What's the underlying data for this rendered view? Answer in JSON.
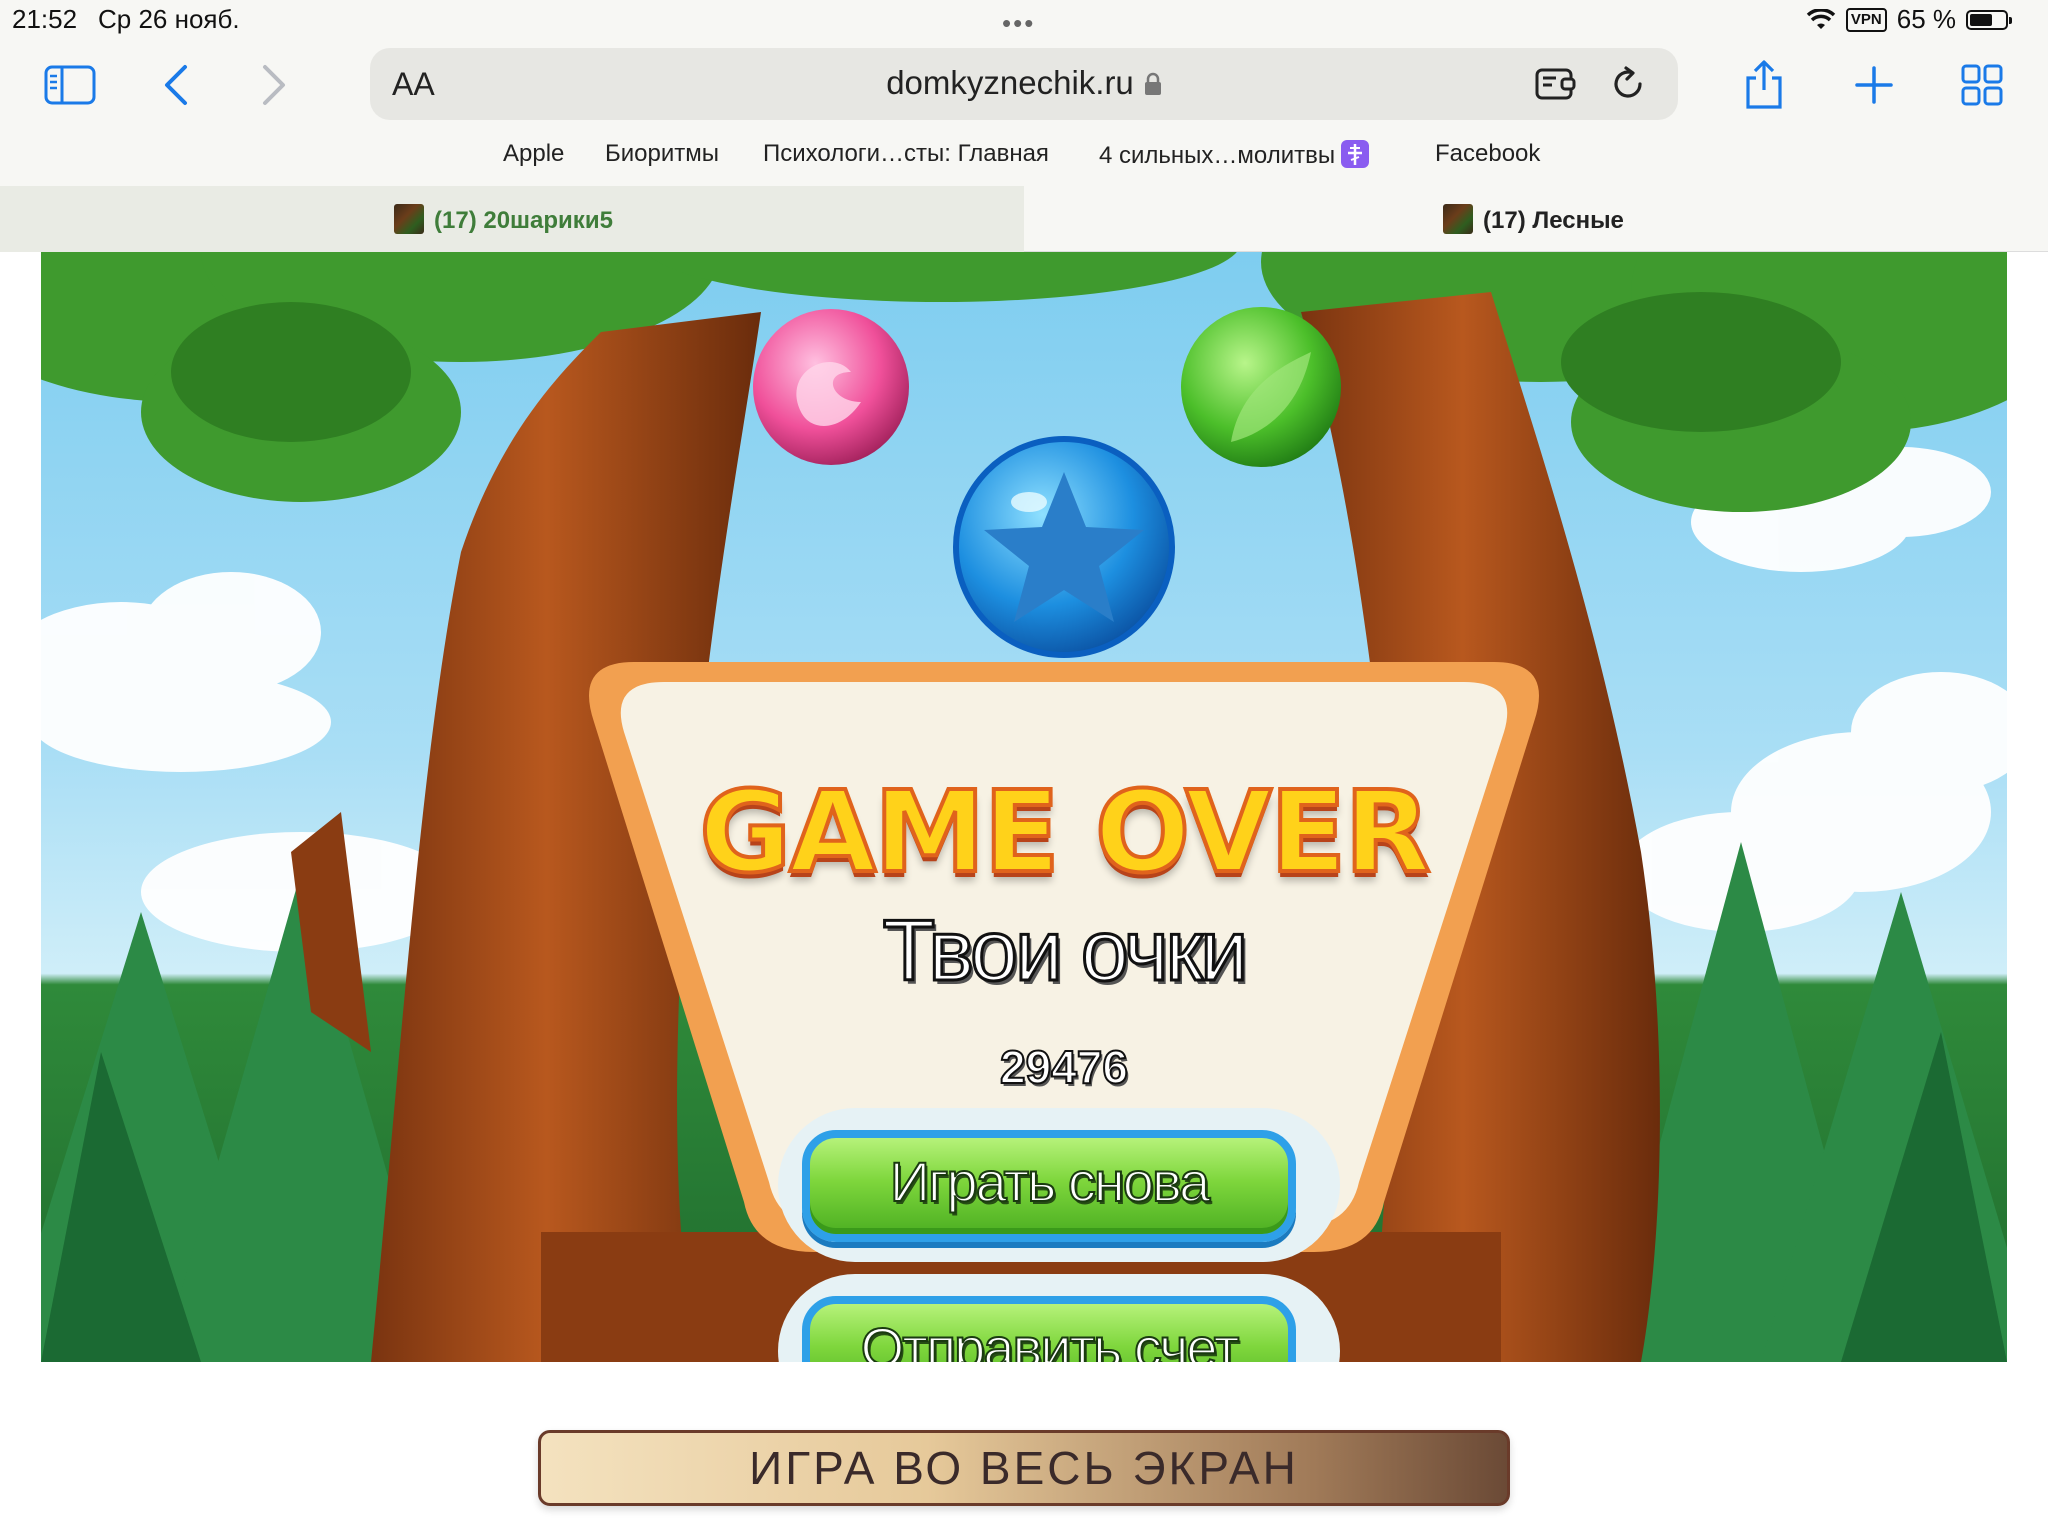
{
  "status_bar": {
    "time": "21:52",
    "date": "Ср 26 нояб.",
    "vpn": "VPN",
    "battery": "65 %",
    "battery_level": 0.65
  },
  "toolbar": {
    "text_size_label": "AA",
    "url": "domkyznechik.ru"
  },
  "favorites": [
    {
      "label": "Apple"
    },
    {
      "label": "Биоритмы"
    },
    {
      "label": "Психологи…сты: Главная"
    },
    {
      "label": "4 сильных…молитвы"
    },
    {
      "label": "Facebook"
    }
  ],
  "tabs": [
    {
      "title": "(17) 20шарики5",
      "active": true
    },
    {
      "title": "(17) Лесные",
      "active": false
    }
  ],
  "game": {
    "title": "GAME OVER",
    "score_label": "Твои очки",
    "score": "29476",
    "play_again": "Играть снова",
    "submit_score": "Отправить счет"
  },
  "fullscreen_button": "ИГРА ВО ВЕСЬ ЭКРАН",
  "colors": {
    "accent_blue": "#1a7ae8",
    "tab_active_text": "#3f7d3a",
    "game_button_green": "#7ed63c",
    "game_title_yellow": "#ffd21a"
  }
}
